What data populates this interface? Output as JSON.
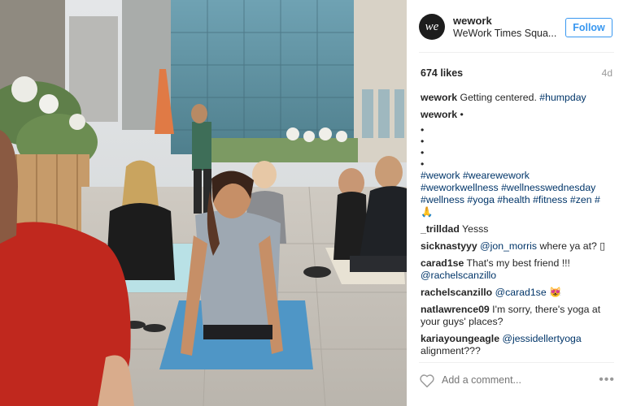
{
  "post": {
    "username": "wework",
    "location": "WeWork Times Squa...",
    "follow_label": "Follow",
    "avatar_text": "we",
    "likes": "674 likes",
    "age": "4d",
    "caption": {
      "user": "wework",
      "text": " Getting centered. ",
      "tag": "#humpday"
    },
    "comments": [
      {
        "user": "wework",
        "text": " •"
      },
      {
        "user": "_trilldad",
        "text": " Yesss"
      },
      {
        "user": "sicknastyyy",
        "mention": "@jon_morris",
        "text": " where ya at? ▯"
      },
      {
        "user": "carad1se",
        "text": " That's my best friend !!! ",
        "mention2": "@rachelscanzillo"
      },
      {
        "user": "rachelscanzillo",
        "mention": "@carad1se",
        "text": " 😻"
      },
      {
        "user": "natlawrence09",
        "text": " I'm sorry, there's yoga at your guys' places?"
      },
      {
        "user": "kariayoungeagle",
        "mention": "@jessidellertyoga",
        "text": " alignment???"
      }
    ],
    "bullets": [
      "•",
      "•",
      "•",
      "•"
    ],
    "hashtags": "#wework #wearewework #weworkwellness #wellnesswednesday #wellness #yoga #health #fitness #zen #🙏",
    "add_comment_placeholder": "Add a comment...",
    "more_label": "•••"
  },
  "icons": {
    "like": "heart-icon",
    "more": "more-options-icon"
  },
  "colors": {
    "accent": "#3897f0",
    "tag": "#003569",
    "muted": "#999999"
  }
}
